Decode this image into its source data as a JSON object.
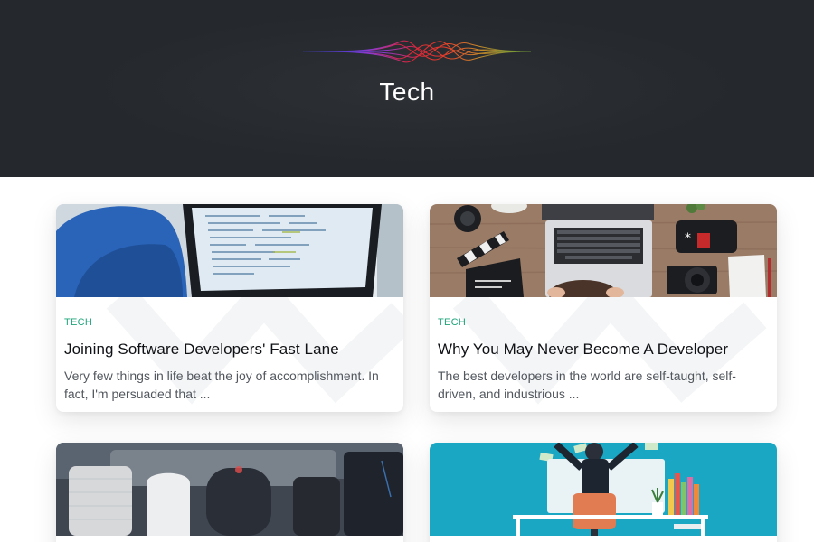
{
  "header": {
    "title": "Tech",
    "background_color": "#25292d"
  },
  "posts": [
    {
      "category": "TECH",
      "title": "Joining Software Developers' Fast Lane",
      "excerpt": "Very few things in life beat the joy of accomplishment. In fact, I'm persuaded that ...",
      "image_icon": "laptop-code-photo"
    },
    {
      "category": "TECH",
      "title": "Why You May Never Become A Developer",
      "excerpt": "The best developers in the world are self-taught, self-driven, and industrious ...",
      "image_icon": "desk-laptop-camera-photo"
    },
    {
      "category": "",
      "title": "",
      "excerpt": "",
      "image_icon": "smart-speakers-photo"
    },
    {
      "category": "",
      "title": "",
      "excerpt": "",
      "image_icon": "developer-illustration"
    }
  ],
  "colors": {
    "accent": "#1fa57a",
    "title_text": "#0f1115",
    "excerpt_text": "#52575e"
  }
}
